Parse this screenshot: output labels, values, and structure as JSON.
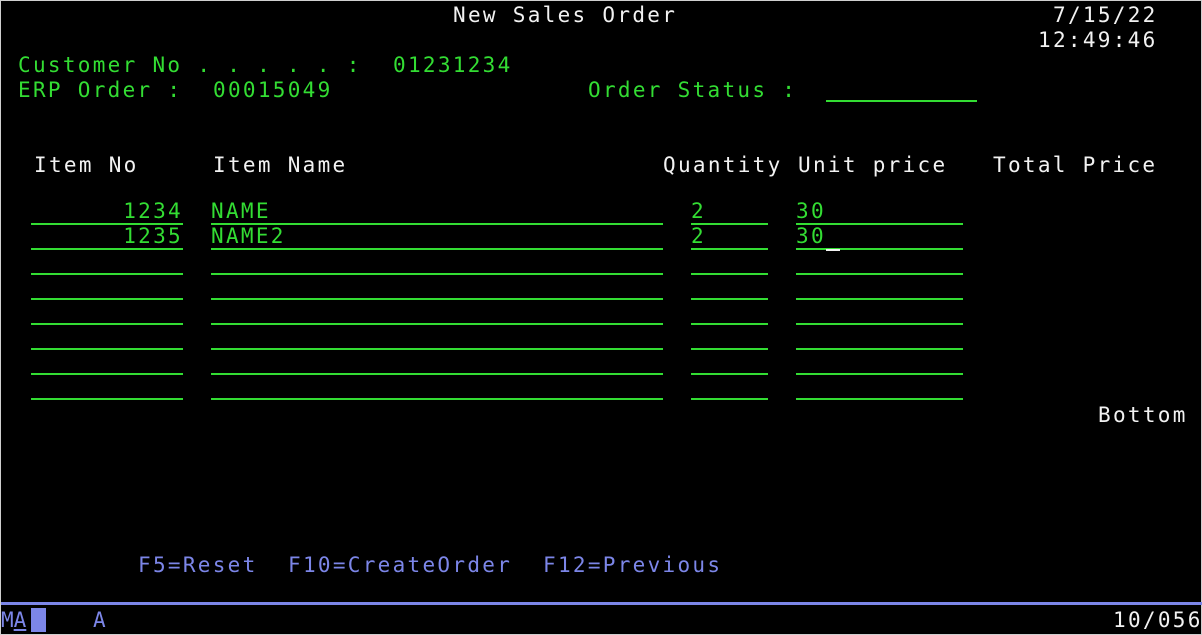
{
  "header": {
    "title": "New Sales Order",
    "date": "7/15/22",
    "time": "12:49:46"
  },
  "customer": {
    "label": "Customer No . . . . . :",
    "value": "01231234"
  },
  "erp_order": {
    "label": "ERP Order :",
    "value": "00015049"
  },
  "order_status": {
    "label": "Order Status :",
    "value": ""
  },
  "table": {
    "columns": {
      "item_no": "Item No",
      "item_name": "Item Name",
      "quantity": "Quantity",
      "unit_price": "Unit price",
      "total_price": "Total Price"
    },
    "rows": [
      {
        "item_no": "1234",
        "item_name": "NAME",
        "quantity": "2",
        "unit_price": "30",
        "total_price": ""
      },
      {
        "item_no": "1235",
        "item_name": "NAME2",
        "quantity": "2",
        "unit_price": "30",
        "total_price": ""
      },
      {
        "item_no": "",
        "item_name": "",
        "quantity": "",
        "unit_price": "",
        "total_price": ""
      },
      {
        "item_no": "",
        "item_name": "",
        "quantity": "",
        "unit_price": "",
        "total_price": ""
      },
      {
        "item_no": "",
        "item_name": "",
        "quantity": "",
        "unit_price": "",
        "total_price": ""
      },
      {
        "item_no": "",
        "item_name": "",
        "quantity": "",
        "unit_price": "",
        "total_price": ""
      },
      {
        "item_no": "",
        "item_name": "",
        "quantity": "",
        "unit_price": "",
        "total_price": ""
      },
      {
        "item_no": "",
        "item_name": "",
        "quantity": "",
        "unit_price": "",
        "total_price": ""
      }
    ],
    "scroll_indicator": "Bottom"
  },
  "function_keys": [
    {
      "key": "F5",
      "label": "F5=Reset"
    },
    {
      "key": "F10",
      "label": "F10=CreateOrder"
    },
    {
      "key": "F12",
      "label": "F12=Previous"
    }
  ],
  "oia": {
    "mode_m": "M",
    "mode_a": "A",
    "input_indicator": "A",
    "cursor_position": "10/056"
  },
  "colors": {
    "field_green": "#33dd33",
    "text_white": "#f2f2f2",
    "fkey_blue": "#7c86e8",
    "background": "#000000"
  }
}
